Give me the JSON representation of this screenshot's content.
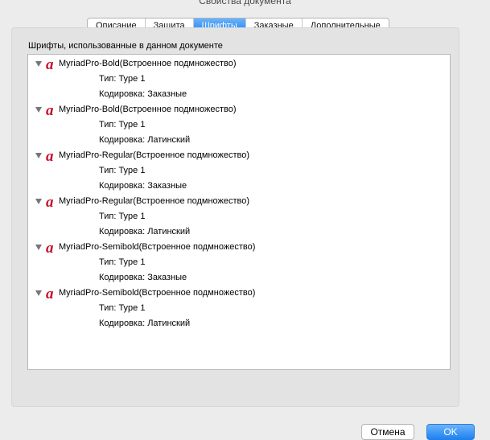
{
  "window": {
    "title": "Свойства документа"
  },
  "tabs": [
    {
      "label": "Описание"
    },
    {
      "label": "Защита"
    },
    {
      "label": "Шрифты"
    },
    {
      "label": "Заказные"
    },
    {
      "label": "Дополнительные"
    }
  ],
  "active_tab": "Шрифты",
  "fonts_section": {
    "label": "Шрифты, использованные в данном документе",
    "fonts": [
      {
        "name": "MyriadPro-Bold(Встроенное подмножество)",
        "type": "Тип: Type 1",
        "encoding": "Кодировка: Заказные"
      },
      {
        "name": "MyriadPro-Bold(Встроенное подмножество)",
        "type": "Тип: Type 1",
        "encoding": "Кодировка: Латинский"
      },
      {
        "name": "MyriadPro-Regular(Встроенное подмножество)",
        "type": "Тип: Type 1",
        "encoding": "Кодировка: Заказные"
      },
      {
        "name": "MyriadPro-Regular(Встроенное подмножество)",
        "type": "Тип: Type 1",
        "encoding": "Кодировка: Латинский"
      },
      {
        "name": "MyriadPro-Semibold(Встроенное подмножество)",
        "type": "Тип: Type 1",
        "encoding": "Кодировка: Заказные"
      },
      {
        "name": "MyriadPro-Semibold(Встроенное подмножество)",
        "type": "Тип: Type 1",
        "encoding": "Кодировка: Латинский"
      }
    ]
  },
  "buttons": {
    "cancel": "Отмена",
    "ok": "OK"
  },
  "colors": {
    "accent": "#1e82f3",
    "font_icon": "#c8102e"
  },
  "icons": {
    "font": "acrobat-font-icon",
    "disclosure": "disclosure-triangle-icon"
  }
}
